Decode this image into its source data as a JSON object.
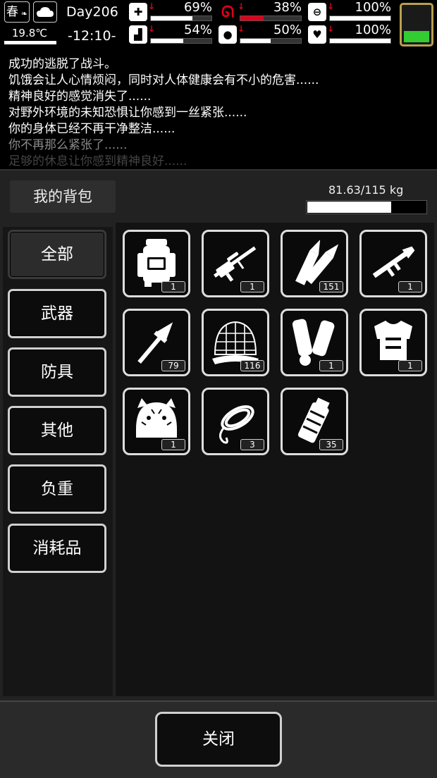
{
  "hud": {
    "season": "春",
    "temperature": "19.8℃",
    "day": "Day206",
    "time": "-12:10-",
    "stats": [
      {
        "name": "health",
        "value": "69%",
        "level": 0.69,
        "fill_color": "#ffffff"
      },
      {
        "name": "hunger",
        "value": "38%",
        "level": 0.38,
        "fill_color": "#e0001b"
      },
      {
        "name": "energy",
        "value": "100%",
        "level": 1.0,
        "fill_color": "#ffffff"
      },
      {
        "name": "stamina",
        "value": "54%",
        "level": 0.54,
        "fill_color": "#ffffff"
      },
      {
        "name": "thirst",
        "value": "50%",
        "level": 0.5,
        "fill_color": "#ffffff"
      },
      {
        "name": "mood",
        "value": "100%",
        "level": 1.0,
        "fill_color": "#ffffff"
      }
    ],
    "battery_color": "#33cc33"
  },
  "log": [
    "成功的逃脱了战斗。",
    "饥饿会让人心情烦闷，同时对人体健康会有不小的危害......",
    "精神良好的感觉消失了......",
    "对野外环境的未知恐惧让你感到一丝紧张......",
    "你的身体已经不再干净整洁......",
    "你不再那么紧张了......",
    "足够的休息让你感到精神良好......"
  ],
  "backpack": {
    "title": "我的背包",
    "weight": "81.63/115 kg",
    "weight_fraction": 0.71
  },
  "categories": [
    "全部",
    "武器",
    "防具",
    "其他",
    "负重",
    "消耗品"
  ],
  "active_category": "全部",
  "items": [
    {
      "icon": "backpack-icon",
      "qty": "1"
    },
    {
      "icon": "sniper-rifle-icon",
      "qty": "1"
    },
    {
      "icon": "rifle-ammo-icon",
      "qty": "151"
    },
    {
      "icon": "rocket-launcher-icon",
      "qty": "1"
    },
    {
      "icon": "rocket-icon",
      "qty": "79"
    },
    {
      "icon": "net-trap-icon",
      "qty": "116"
    },
    {
      "icon": "shin-guards-icon",
      "qty": "1"
    },
    {
      "icon": "body-armor-icon",
      "qty": "1"
    },
    {
      "icon": "tiger-hat-icon",
      "qty": "1"
    },
    {
      "icon": "rope-icon",
      "qty": "3"
    },
    {
      "icon": "grenade-icon",
      "qty": "35"
    }
  ],
  "close_label": "关闭"
}
